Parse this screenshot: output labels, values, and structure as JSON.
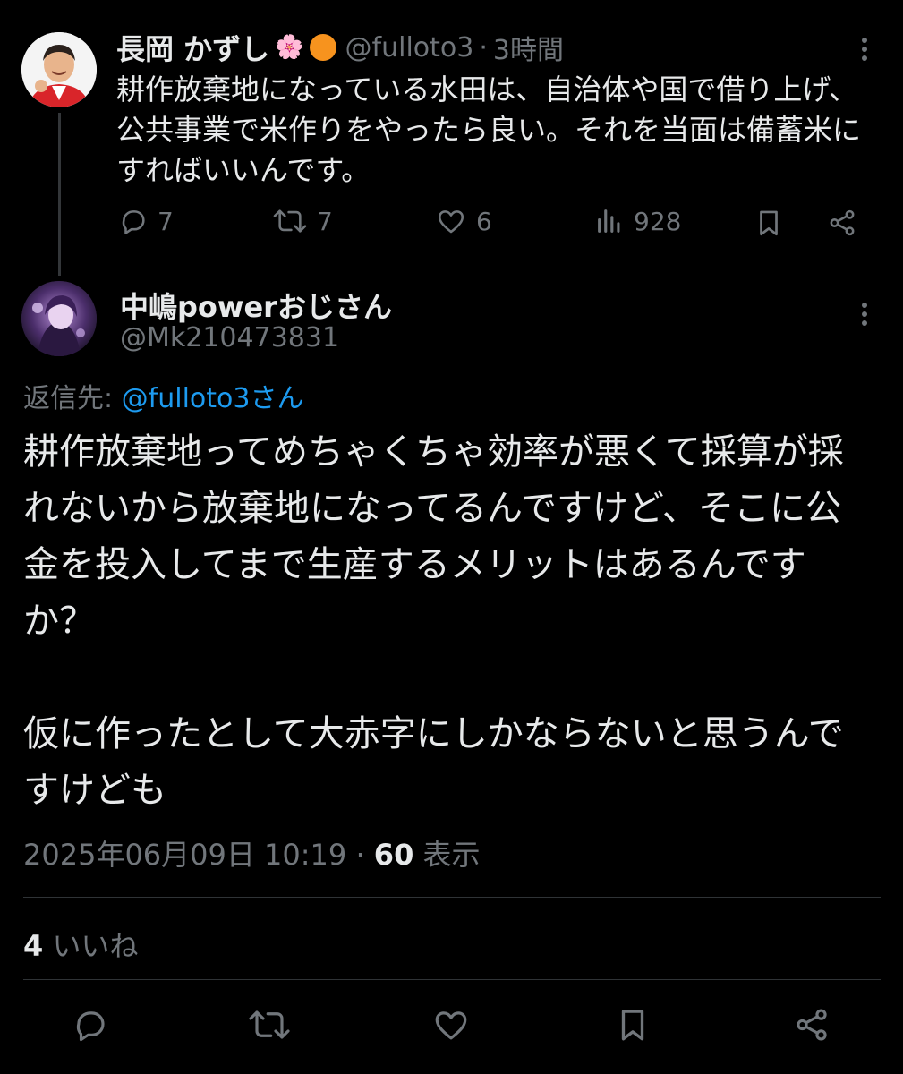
{
  "parent": {
    "name": "長岡 かずし",
    "emoji": "🌸",
    "handle": "@fulloto3",
    "sep": "·",
    "time": "3時間",
    "text": "耕作放棄地になっている水田は、自治体や国で借り上げ、公共事業で米作りをやったら良い。それを当面は備蓄米にすればいいんです。",
    "stats": {
      "replies": "7",
      "retweets": "7",
      "likes": "6",
      "views": "928"
    }
  },
  "reply": {
    "name": "中嶋powerおじさん",
    "handle": "@Mk210473831",
    "reply_to_label": "返信先:",
    "reply_to_handle": "@fulloto3さん",
    "paragraph1": "耕作放棄地ってめちゃくちゃ効率が悪くて採算が採れないから放棄地になってるんですけど、そこに公金を投入してまで生産するメリットはあるんですか？",
    "paragraph2": "仮に作ったとして大赤字にしかならないと思うんですけども",
    "datetime": "2025年06月09日 10:19",
    "meta_sep": "·",
    "views": "60",
    "views_label": "表示",
    "likes": "4",
    "likes_label": "いいね"
  },
  "colors": {
    "background": "#000000",
    "text": "#e7e9ea",
    "muted": "#71767b",
    "link": "#1d9bf0",
    "divider": "#2f3336"
  }
}
